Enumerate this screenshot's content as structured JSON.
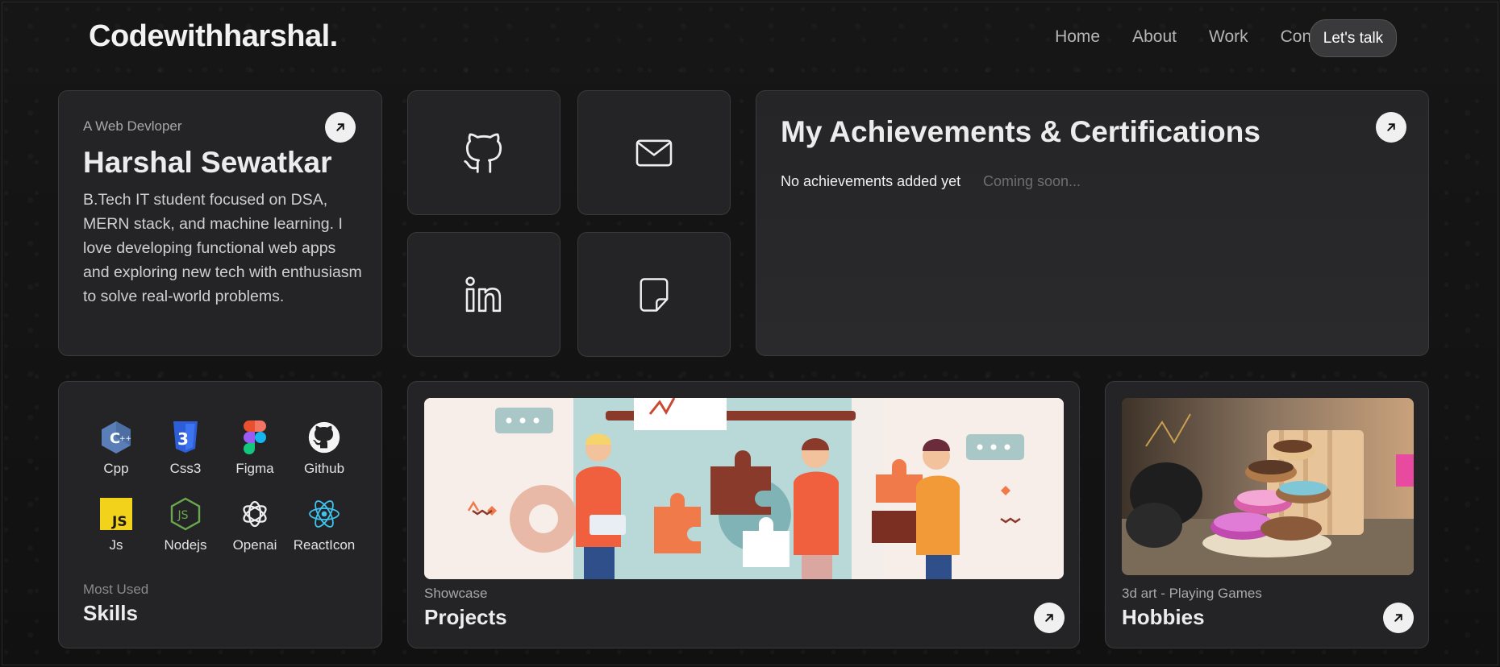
{
  "header": {
    "logo": "Codewithharshal.",
    "nav": [
      "Home",
      "About",
      "Work",
      "Contact"
    ],
    "cta": "Let's talk"
  },
  "intro": {
    "role": "A Web Devloper",
    "name": "Harshal Sewatkar",
    "bio": "B.Tech IT student focused on DSA, MERN stack, and machine learning. I love developing functional web apps and exploring new tech with enthusiasm to solve real-world problems."
  },
  "social_icons": [
    "github-icon",
    "mail-icon",
    "linkedin-icon",
    "resume-note-icon"
  ],
  "achievements": {
    "title": "My Achievements & Certifications",
    "empty_text": "No achievements added yet",
    "soon_text": "Coming soon..."
  },
  "skills": {
    "items": [
      "Cpp",
      "Css3",
      "Figma",
      "Github",
      "Js",
      "Nodejs",
      "Openai",
      "ReactIcon"
    ],
    "subtitle": "Most Used",
    "title": "Skills"
  },
  "projects": {
    "subtitle": "Showcase",
    "title": "Projects"
  },
  "hobbies": {
    "subtitle": "3d art - Playing Games",
    "title": "Hobbies"
  },
  "colors": {
    "background": "#141414",
    "card": "#242426",
    "card_border": "#3a3a3c",
    "accent_orange": "#f07a4a"
  }
}
